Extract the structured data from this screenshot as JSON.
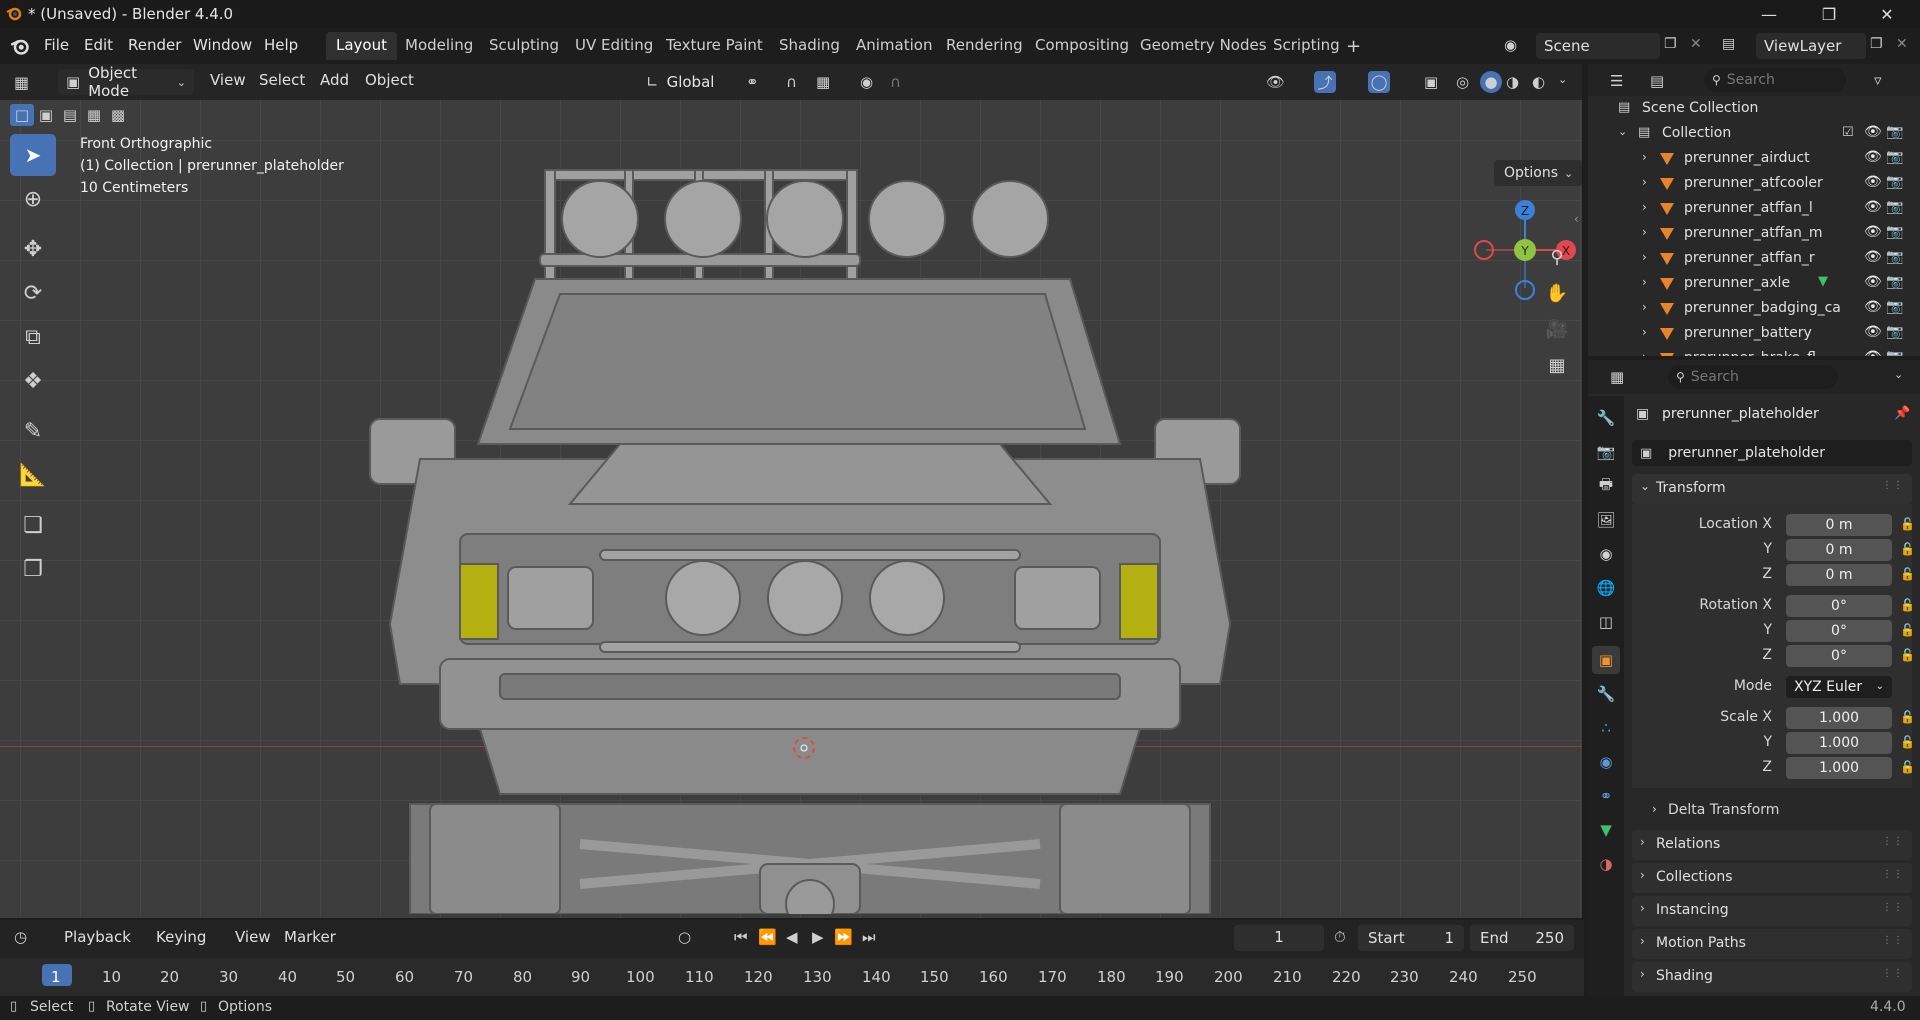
{
  "title_bar": {
    "title": "* (Unsaved) - Blender 4.4.0"
  },
  "menu": {
    "file": "File",
    "edit": "Edit",
    "render": "Render",
    "window": "Window",
    "help": "Help"
  },
  "workspaces": [
    "Layout",
    "Modeling",
    "Sculpting",
    "UV Editing",
    "Texture Paint",
    "Shading",
    "Animation",
    "Rendering",
    "Compositing",
    "Geometry Nodes",
    "Scripting"
  ],
  "scene": {
    "name": "Scene",
    "view_layer": "ViewLayer"
  },
  "viewport_header": {
    "mode": "Object Mode",
    "menus": [
      "View",
      "Select",
      "Add",
      "Object"
    ],
    "transform_orientation": "Global",
    "options_label": "Options"
  },
  "viewport_overlay": {
    "view_name": "Front Orthographic",
    "collection_info": "(1) Collection | prerunner_plateholder",
    "scale": "10 Centimeters"
  },
  "gizmo": {
    "z": "Z",
    "y": "Y",
    "x": "X"
  },
  "outliner": {
    "search_placeholder": "Search",
    "scene_collection": "Scene Collection",
    "collection": "Collection",
    "items": [
      "prerunner_airduct",
      "prerunner_atfcooler",
      "prerunner_atffan_l",
      "prerunner_atffan_m",
      "prerunner_atffan_r",
      "prerunner_axle",
      "prerunner_badging_ca",
      "prerunner_battery",
      "prerunner_brake_fl"
    ]
  },
  "properties": {
    "search_placeholder": "Search",
    "object_name": "prerunner_plateholder",
    "object_field": "prerunner_plateholder",
    "transform_label": "Transform",
    "location_label": "Location X",
    "rotation_label": "Rotation X",
    "scale_label": "Scale X",
    "y_label": "Y",
    "z_label": "Z",
    "mode_label": "Mode",
    "location": [
      "0 m",
      "0 m",
      "0 m"
    ],
    "rotation": [
      "0°",
      "0°",
      "0°"
    ],
    "mode_value": "XYZ Euler",
    "scale": [
      "1.000",
      "1.000",
      "1.000"
    ],
    "delta_transform": "Delta Transform",
    "panels": [
      "Relations",
      "Collections",
      "Instancing",
      "Motion Paths",
      "Shading"
    ]
  },
  "timeline": {
    "playback": "Playback",
    "keying": "Keying",
    "view": "View",
    "marker": "Marker",
    "current_frame": "1",
    "start_label": "Start",
    "start_value": "1",
    "end_label": "End",
    "end_value": "250",
    "ruler": [
      "1",
      "10",
      "20",
      "30",
      "40",
      "50",
      "60",
      "70",
      "80",
      "90",
      "100",
      "110",
      "120",
      "130",
      "140",
      "150",
      "160",
      "170",
      "180",
      "190",
      "200",
      "210",
      "220",
      "230",
      "240",
      "250"
    ]
  },
  "status_bar": {
    "select": "Select",
    "rotate_view": "Rotate View",
    "options": "Options",
    "version": "4.4.0"
  },
  "colors": {
    "accent": "#4772b3",
    "selection_orange": "#e8842c",
    "axis_x": "#e0474f",
    "axis_y": "#8fc341",
    "axis_z": "#3b82d6"
  }
}
